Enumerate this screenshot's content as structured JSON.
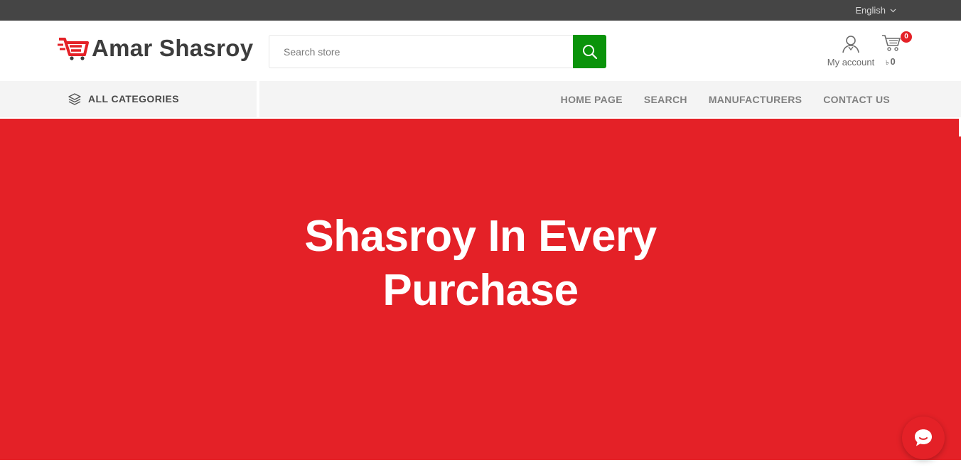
{
  "topbar": {
    "language": "English"
  },
  "header": {
    "logo_text": "Amar Shasroy",
    "search_placeholder": "Search store",
    "account_label": "My account",
    "cart_count": "0",
    "cart_currency": "৳",
    "cart_total": "0"
  },
  "nav": {
    "all_categories": "ALL CATEGORIES",
    "items": [
      {
        "label": "HOME PAGE"
      },
      {
        "label": "SEARCH"
      },
      {
        "label": "MANUFACTURERS"
      },
      {
        "label": "CONTACT US"
      }
    ]
  },
  "hero": {
    "title_line1": "Shasroy In Every",
    "title_line2": "Purchase"
  },
  "colors": {
    "topbar": "#454545",
    "brand_red": "#e42127",
    "search_green": "#0a930a",
    "nav_bg": "#f4f4f4"
  },
  "icons": {
    "logo": "shopping-cart-logo-icon",
    "search": "search-icon",
    "account": "user-icon",
    "cart": "cart-icon",
    "categories": "layers-icon",
    "chat": "chat-bubble-icon",
    "language": "chevron-down-icon"
  }
}
